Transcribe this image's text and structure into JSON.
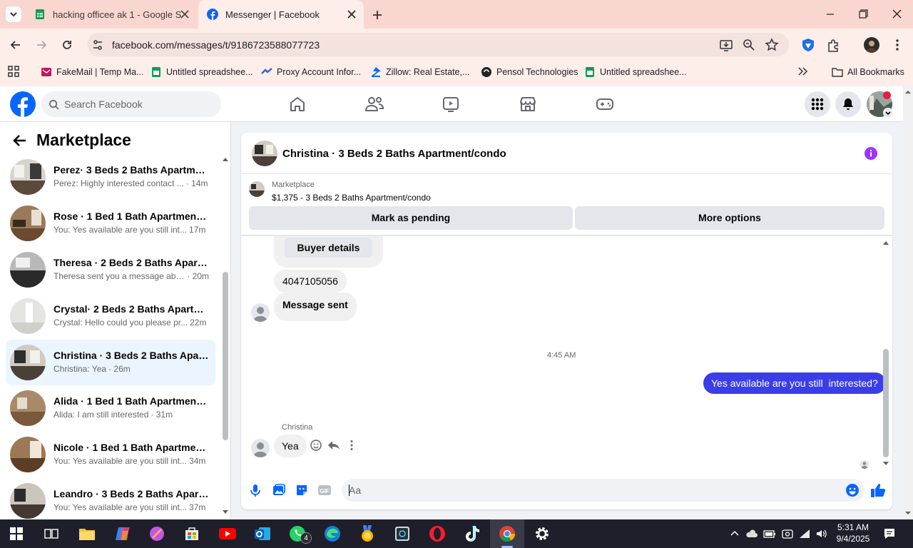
{
  "browser": {
    "tabs": [
      {
        "title": "hacking officee ak 1 - Google Sl",
        "active": false
      },
      {
        "title": "Messenger | Facebook",
        "active": true
      }
    ],
    "url": "facebook.com/messages/t/9186723588077723",
    "bookmarks": [
      {
        "label": "FakeMail | Temp Ma...",
        "icon": "fakemail-icon"
      },
      {
        "label": "Untitled spreadshee...",
        "icon": "sheets-icon"
      },
      {
        "label": "Proxy Account Infor...",
        "icon": "proxy-icon"
      },
      {
        "label": "Zillow: Real Estate,...",
        "icon": "zillow-icon"
      },
      {
        "label": "Pensol Technologies",
        "icon": "pensol-icon"
      },
      {
        "label": "Untitled spreadshee...",
        "icon": "sheets-icon"
      }
    ],
    "all_bookmarks": "All Bookmarks"
  },
  "facebook": {
    "search_placeholder": "Search Facebook",
    "brand_color": "#0866ff"
  },
  "sidebar": {
    "title": "Marketplace",
    "conversations": [
      {
        "title": "Perez· 3 Beds 2 Baths Apartmen...",
        "preview": "Perez: Highly interested contact ...",
        "time": " · 14m"
      },
      {
        "title": "Rose · 1 Bed 1 Bath Apartment/c...",
        "preview": "You: Yes available are you still int...",
        "time": " 17m"
      },
      {
        "title": "Theresa · 2 Beds 2 Baths Apartm...",
        "preview": "Theresa sent you a message abo...",
        "time": " · 20m"
      },
      {
        "title": "Crystal· 2 Beds 2 Baths Apartme...",
        "preview": "Crystal: Hello could you please pr...",
        "time": " 22m"
      },
      {
        "title": "Christina · 3 Beds 2 Baths Apart...",
        "preview": "Christina: Yea",
        "time": " · 26m"
      },
      {
        "title": "Alida · 1 Bed 1 Bath Apartment/c...",
        "preview": "Alida: I am still interested",
        "time": " · 31m"
      },
      {
        "title": "Nicole · 1 Bed 1 Bath Apartment...",
        "preview": "You: Yes available are you still int...",
        "time": " 34m"
      },
      {
        "title": "Leandro · 3 Beds 2 Baths Apart...",
        "preview": "You: Yes available are you still int...",
        "time": " 37m"
      }
    ]
  },
  "chat": {
    "header_title": "Christina · 3 Beds 2 Baths Apartment/condo",
    "listing_source": "Marketplace",
    "listing_title": "$1,375 - 3 Beds 2 Baths Apartment/condo",
    "mark_pending": "Mark as pending",
    "more_options": "More options",
    "buyer_details": "Buyer details",
    "phone": "4047105056",
    "message_sent": "Message sent",
    "timestamp": "4:45 AM",
    "my_message": "Yes available are you still  interested?",
    "sender_name": "Christina",
    "their_message": "Yea",
    "input_placeholder": "Aa"
  },
  "taskbar": {
    "time": "5:31 AM",
    "date": "9/4/2025",
    "whatsapp_badge": "4"
  }
}
